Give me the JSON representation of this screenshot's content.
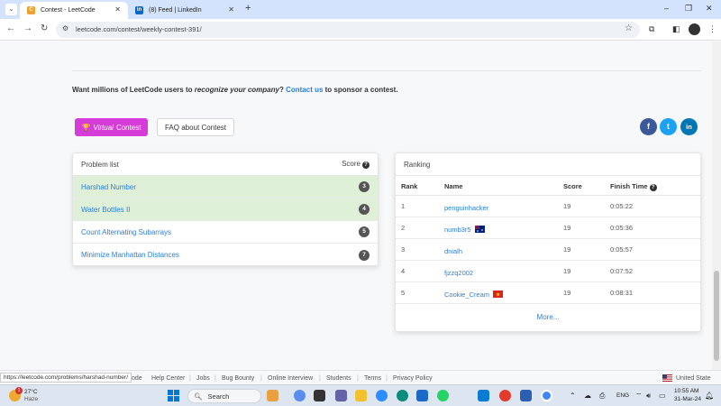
{
  "browser": {
    "tabs": [
      {
        "title": "Contest - LeetCode",
        "active": true
      },
      {
        "title": "(8) Feed | LinkedIn",
        "active": false
      }
    ],
    "new_tab_label": "+",
    "url": "leetcode.com/contest/weekly-contest-391/"
  },
  "sponsor": {
    "prefix": "Want millions of LeetCode users to ",
    "emph": "recognize your company",
    "mid": "? ",
    "link": "Contact us",
    "suffix": " to sponsor a contest."
  },
  "buttons": {
    "virtual_label": "Virtual",
    "virtual_suffix": "Contest",
    "faq_label": "FAQ about Contest"
  },
  "social": {
    "facebook": "f",
    "twitter": "t",
    "linkedin": "in"
  },
  "problems": {
    "header": "Problem list",
    "score_header": "Score",
    "items": [
      {
        "name": "Harshad Number",
        "score": "3",
        "solved": true
      },
      {
        "name": "Water Bottles II",
        "score": "4",
        "solved": true
      },
      {
        "name": "Count Alternating Subarrays",
        "score": "5",
        "solved": false
      },
      {
        "name": "Minimize Manhattan Distances",
        "score": "7",
        "solved": false
      }
    ]
  },
  "ranking": {
    "header": "Ranking",
    "columns": {
      "rank": "Rank",
      "name": "Name",
      "score": "Score",
      "time": "Finish Time"
    },
    "rows": [
      {
        "rank": "1",
        "name": "penguinhacker",
        "score": "19",
        "time": "0:05:22",
        "flag": ""
      },
      {
        "rank": "2",
        "name": "numb3r5",
        "score": "19",
        "time": "0:05:36",
        "flag": "au"
      },
      {
        "rank": "3",
        "name": "dnialh",
        "score": "19",
        "time": "0:05:57",
        "flag": ""
      },
      {
        "rank": "4",
        "name": "fjzzq2002",
        "score": "19",
        "time": "0:07:52",
        "flag": ""
      },
      {
        "rank": "5",
        "name": "Cookie_Cream",
        "score": "19",
        "time": "0:08:31",
        "flag": "vn"
      }
    ],
    "more": "More..."
  },
  "footer": {
    "status_url": "https://leetcode.com/problems/harshad-number/",
    "partial_link": "ode",
    "links": [
      "Help Center",
      "Jobs",
      "Bug Bounty",
      "Online Interview",
      "Students",
      "Terms",
      "Privacy Policy"
    ],
    "region": "United State"
  },
  "taskbar": {
    "weather_badge": "1",
    "temp": "27°C",
    "condition": "Haze",
    "search": "Search",
    "lang": "ENG",
    "time": "10:55 AM",
    "date": "31-Mar-24"
  },
  "colors": {
    "accent_link": "#2a7fd8",
    "virtual_button": "#d63cd8",
    "solved_row": "#dff0d8",
    "facebook": "#3b5998",
    "twitter": "#1da1f2",
    "linkedin": "#0077b5"
  }
}
